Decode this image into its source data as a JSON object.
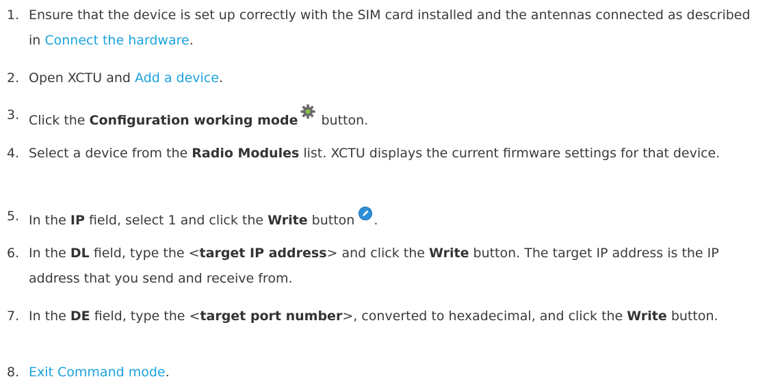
{
  "steps": [
    {
      "num": "1.",
      "parts": {
        "t1": "Ensure that the device is set up correctly with the SIM card installed and the antennas connected as described in ",
        "link": "Connect the hardware",
        "t2": "."
      }
    },
    {
      "num": "2.",
      "parts": {
        "t1": "Open XCTU and ",
        "link": "Add a device",
        "t2": "."
      }
    },
    {
      "num": "3.",
      "parts": {
        "t1": "Click the ",
        "b1": "Configuration working mode",
        "icon": "gear-icon",
        "t2": "button."
      }
    },
    {
      "num": "4.",
      "parts": {
        "t1": "Select a device from the ",
        "b1": "Radio Modules",
        "t2": " list. XCTU displays the current firmware settings for that device."
      }
    },
    {
      "num": "5.",
      "parts": {
        "t1": "In the ",
        "b1": "IP",
        "t2": " field, select 1 and click the ",
        "b2": "Write",
        "t3": " button",
        "icon": "write-icon",
        "t4": "."
      }
    },
    {
      "num": "6.",
      "parts": {
        "t1": "In the ",
        "b1": "DL",
        "t2": " field, type the <",
        "b2": "target IP address",
        "t3": "> and click the ",
        "b3": "Write",
        "t4": " button. The target IP address is the IP address that you send and receive from."
      }
    },
    {
      "num": "7.",
      "parts": {
        "t1": "In the ",
        "b1": "DE",
        "t2": " field, type the <",
        "b2": "target port number",
        "t3": ">, converted to hexadecimal, and click the ",
        "b3": "Write",
        "t4": " button."
      }
    },
    {
      "num": "8.",
      "parts": {
        "link": "Exit Command mode",
        "t1": "."
      }
    }
  ],
  "colors": {
    "text": "#3a3a3a",
    "link": "#1aa3dd",
    "gear_icon": "#6b6b6b",
    "gear_center": "#8bc34a",
    "write_icon": "#2f8fd8"
  }
}
